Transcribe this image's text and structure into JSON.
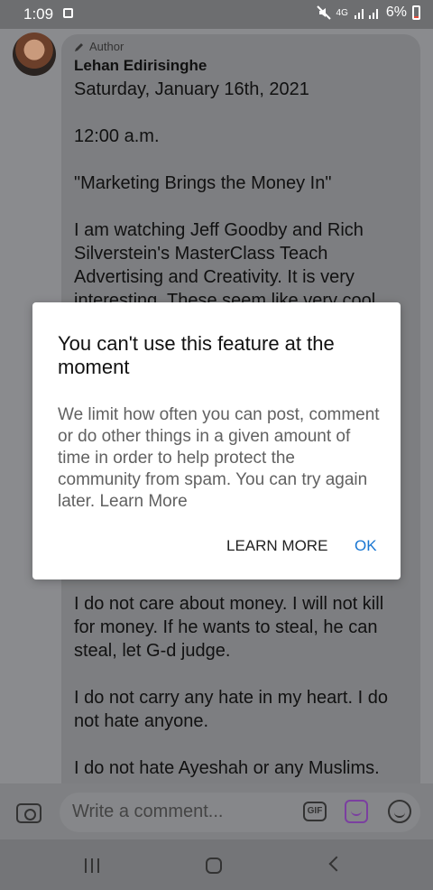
{
  "status_bar": {
    "time": "1:09",
    "network": "4G",
    "battery": "6%"
  },
  "post": {
    "badge": "Author",
    "author": "Lehan Edirisinghe",
    "paragraphs": [
      "Saturday, January 16th, 2021",
      "12:00 a.m.",
      "\"Marketing Brings the Money In\"",
      "I am watching Jeff Goodby and Rich Silverstein's MasterClass Teach Advertising and Creativity. It is very interesting. These seem like very cool"
    ],
    "lower_paragraphs": [
      "I do not care about money. I will not kill for money. If he wants to steal, he can steal, let G-d judge.",
      "I do not carry any hate in my heart. I do not hate anyone.",
      "I do not hate Ayeshah or any Muslims."
    ]
  },
  "dialog": {
    "title": "You can't use this feature at the moment",
    "body": "We limit how often you can post, comment or do other things in a given amount of time in order to help protect the community from spam. You can try again later. Learn More",
    "learn_more": "LEARN MORE",
    "ok": "OK",
    "accent": "#1976d2"
  },
  "composer": {
    "placeholder": "Write a comment...",
    "gif": "GIF"
  },
  "icons": [
    "notification-icon",
    "mute-icon",
    "signal-icon",
    "battery-icon",
    "pencil-icon",
    "camera-icon",
    "gif-icon",
    "sticker-icon",
    "emoji-icon",
    "recent-apps-icon",
    "home-icon",
    "back-icon"
  ]
}
